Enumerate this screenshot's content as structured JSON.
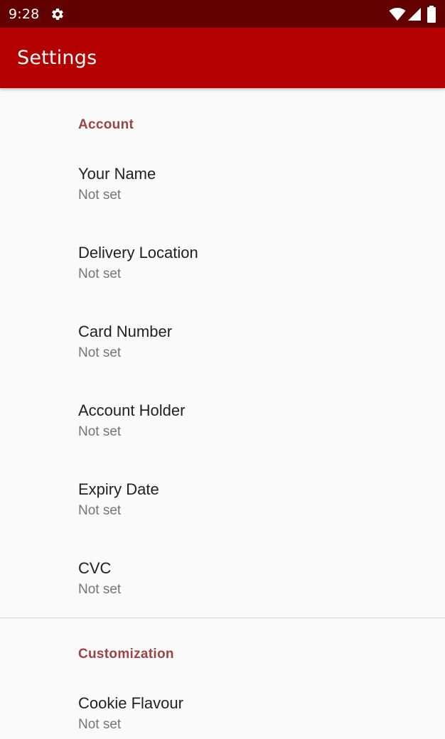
{
  "status_bar": {
    "time": "9:28",
    "icons": [
      "gear-icon",
      "wifi-icon",
      "signal-icon",
      "battery-icon"
    ]
  },
  "app_bar": {
    "title": "Settings"
  },
  "categories": [
    {
      "title": "Account",
      "items": [
        {
          "title": "Your Name",
          "summary": "Not set"
        },
        {
          "title": "Delivery Location",
          "summary": "Not set"
        },
        {
          "title": "Card Number",
          "summary": "Not set"
        },
        {
          "title": "Account Holder",
          "summary": "Not set"
        },
        {
          "title": "Expiry Date",
          "summary": "Not set"
        },
        {
          "title": "CVC",
          "summary": "Not set"
        }
      ]
    },
    {
      "title": "Customization",
      "items": [
        {
          "title": "Cookie Flavour",
          "summary": "Not set"
        }
      ]
    }
  ],
  "colors": {
    "status_bar": "#620000",
    "app_bar": "#b40000",
    "category_text": "#9d4343",
    "background": "#fafafa"
  }
}
